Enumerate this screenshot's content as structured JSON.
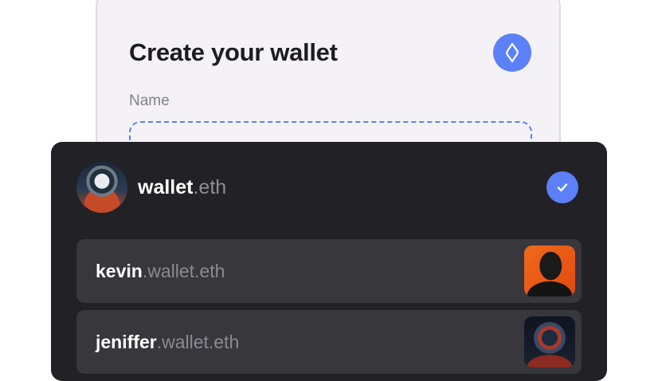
{
  "create_card": {
    "title": "Create your wallet",
    "name_label": "Name"
  },
  "wallet_picker": {
    "selected": {
      "name": "wallet",
      "suffix": ".eth"
    },
    "subnames": [
      {
        "name": "kevin",
        "suffix": ".wallet.eth"
      },
      {
        "name": "jeniffer",
        "suffix": ".wallet.eth"
      }
    ]
  },
  "colors": {
    "accent": "#5b80f7",
    "card_bg": "#f4f2f6",
    "dark_card": "#222125",
    "row_bg": "#38373c"
  },
  "icons": {
    "badge": "ens-logo-icon",
    "check": "checkmark-icon"
  }
}
